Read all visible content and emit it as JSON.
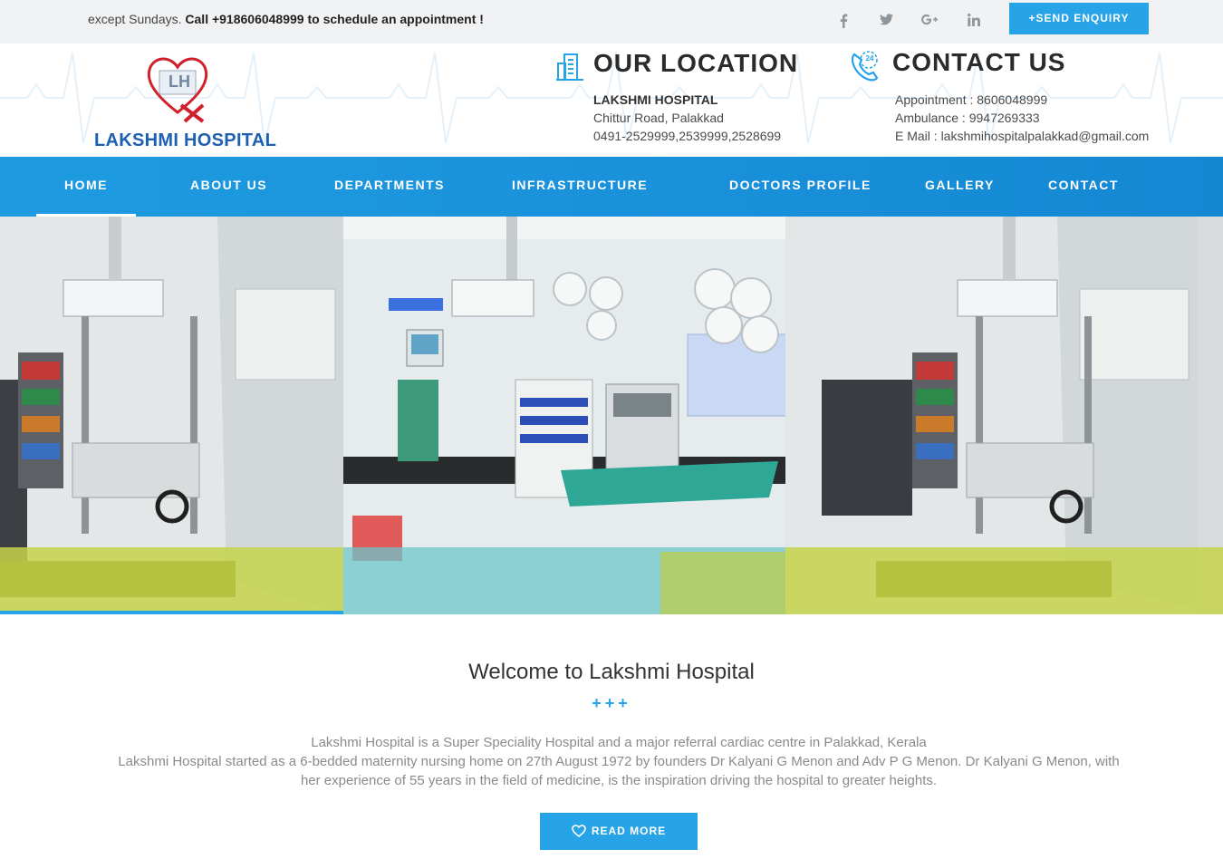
{
  "topbar": {
    "ticker_prefix": "except Sundays. ",
    "ticker_bold": "Call +918606048999 to schedule an appointment !",
    "social": [
      {
        "icon": "facebook-icon",
        "glyph": "f"
      },
      {
        "icon": "twitter-icon",
        "glyph": "t"
      },
      {
        "icon": "google-plus-icon",
        "glyph": "G+"
      },
      {
        "icon": "linkedin-icon",
        "glyph": "in"
      }
    ],
    "enquiry_label": "+SEND ENQUIRY"
  },
  "header": {
    "logo_initials": "LH",
    "logo_name": "LAKSHMI HOSPITAL",
    "location": {
      "title": "OUR LOCATION",
      "name": "LAKSHMI HOSPITAL",
      "address": "Chittur Road, Palakkad",
      "phones": "0491-2529999,2539999,2528699"
    },
    "contact": {
      "title": "CONTACT US",
      "badge": "24",
      "appointment": "Appointment : 8606048999",
      "ambulance": "Ambulance : 9947269333",
      "email": "E Mail : lakshmihospitalpalakkad@gmail.com"
    }
  },
  "nav": {
    "items": [
      {
        "label": "HOME",
        "active": true
      },
      {
        "label": "ABOUT US",
        "active": false
      },
      {
        "label": "DEPARTMENTS",
        "active": false
      },
      {
        "label": "INFRASTRUCTURE",
        "active": false
      },
      {
        "label": "DOCTORS PROFILE",
        "active": false
      },
      {
        "label": "GALLERY",
        "active": false
      },
      {
        "label": "CONTACT",
        "active": false
      }
    ]
  },
  "welcome": {
    "title": "Welcome to Lakshmi Hospital",
    "separator": "+++",
    "paragraph_1": "Lakshmi Hospital is a Super Speciality Hospital and a major referral cardiac centre in Palakkad, Kerala",
    "paragraph_2a": "Lakshmi Hospital started as a 6-bedded maternity nursing home on 27th August 1972 by founders Dr Kalyani G Menon and Adv P G Menon. Dr Kalyani G Menon, with",
    "paragraph_2b": "her experience of 55 years in the field of medicine, is the inspiration driving the hospital to greater heights.",
    "read_more": "READ MORE"
  },
  "colors": {
    "accent": "#27a3e8",
    "nav": "#1a92db",
    "logo_blue": "#1d5fb0",
    "logo_red": "#d0202a"
  }
}
